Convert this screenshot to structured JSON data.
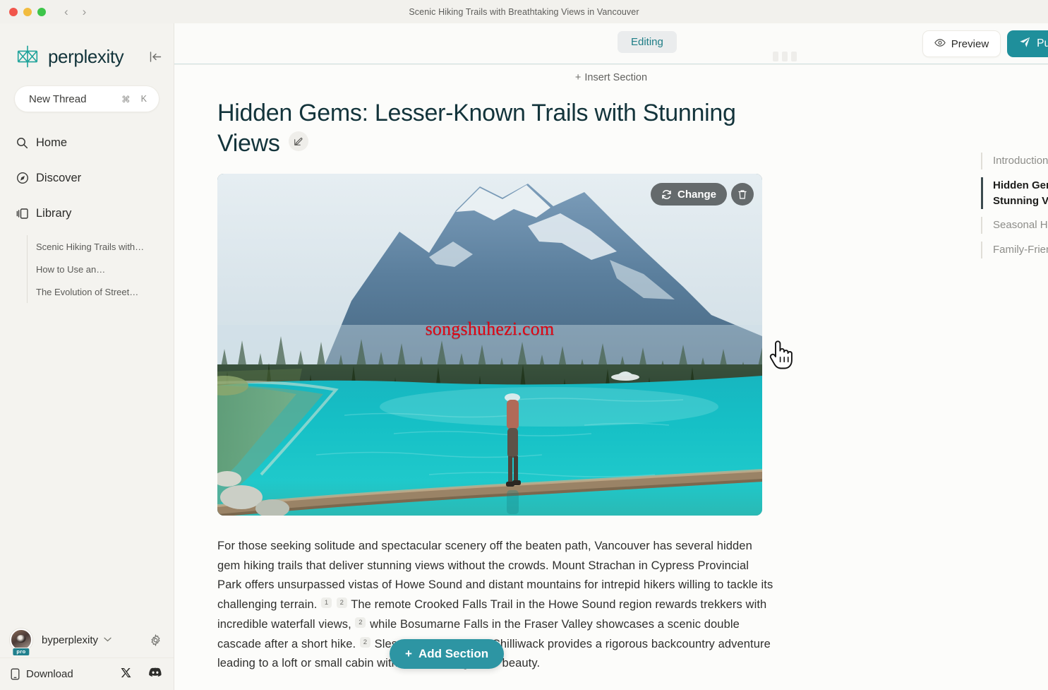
{
  "window": {
    "title": "Scenic Hiking Trails with Breathtaking Views in Vancouver",
    "traffic_lights": [
      "close",
      "minimize",
      "maximize"
    ],
    "back_glyph": "‹",
    "forward_glyph": "›"
  },
  "sidebar": {
    "brand": "perplexity",
    "collapse_icon": "collapse-sidebar-icon",
    "new_thread": {
      "label": "New Thread",
      "shortcut_modifier": "⌘",
      "shortcut_key": "K"
    },
    "nav": [
      {
        "label": "Home",
        "icon": "search-icon"
      },
      {
        "label": "Discover",
        "icon": "compass-icon"
      },
      {
        "label": "Library",
        "icon": "library-icon"
      }
    ],
    "threads": [
      "Scenic Hiking Trails with…",
      "How to Use an…",
      "The Evolution of Street…"
    ],
    "account": {
      "name": "byperplexity",
      "badge": "pro",
      "caret_glyph": "⌄",
      "settings_icon": "gear-icon"
    },
    "footer": {
      "download_label": "Download",
      "download_icon": "phone-icon",
      "socials": [
        "x-icon",
        "discord-icon"
      ]
    }
  },
  "toolbar": {
    "mode_label": "Editing",
    "preview_label": "Preview",
    "preview_icon": "eye-icon",
    "publish_label": "Publish",
    "publish_icon": "send-icon"
  },
  "main": {
    "insert_section_label": "Insert Section",
    "insert_section_plus": "+",
    "doc_title": "Hidden Gems: Lesser-Known Trails with Stunning Views",
    "edit_title_icon": "edit-pencil-icon",
    "hero": {
      "alt": "Hiker walking on a fallen log across a turquoise glacial lake with a snow-capped mountain and dense conifer forest",
      "watermark": "songshuhezi.com",
      "change_label": "Change",
      "change_icon": "refresh-icon",
      "delete_icon": "trash-icon"
    },
    "paragraph": {
      "part1": "For those seeking solitude and spectacular scenery off the beaten path, Vancouver has several hidden gem hiking trails that deliver stunning views without the crowds. Mount Strachan in Cypress Provincial Park offers unsurpassed vistas of Howe Sound and distant mountains for intrepid hikers willing to tackle its challenging terrain.",
      "cite1": "1",
      "cite2": "2",
      "part2": "The remote Crooked Falls Trail in the Howe Sound region rewards trekkers with incredible waterfall views,",
      "cite3": "2",
      "part3": "while Bosumarne Falls in the Fraser Valley showcases a scenic double cascade after a short hike.",
      "cite4": "2",
      "part4": "Slesse Mountain near Chilliwack provides a rigorous backcountry",
      "part5": "adventure leading to a loft or small cabin with commanding other beauty."
    },
    "add_section_label": "Add Section",
    "add_section_plus": "+"
  },
  "outline": {
    "items": [
      {
        "label": "Introduction",
        "active": false
      },
      {
        "label": "Hidden Gems: Lesser-Known Trails with Stunning Views",
        "active": true
      },
      {
        "label": "Seasonal Hiking: Best Trails for Each Season",
        "active": false
      },
      {
        "label": "Family-Friendly Hikes with Scenic Spots",
        "active": false
      }
    ]
  },
  "colors": {
    "accent_teal": "#20808d",
    "publish_teal": "#1f8f9b",
    "add_section_teal": "#2d95a3",
    "sidebar_bg": "#f4f3ef",
    "content_bg": "#fcfcfa",
    "watermark_red": "#e3000f",
    "title_ink": "#13343b"
  },
  "cursor": {
    "type": "pointing-hand"
  }
}
